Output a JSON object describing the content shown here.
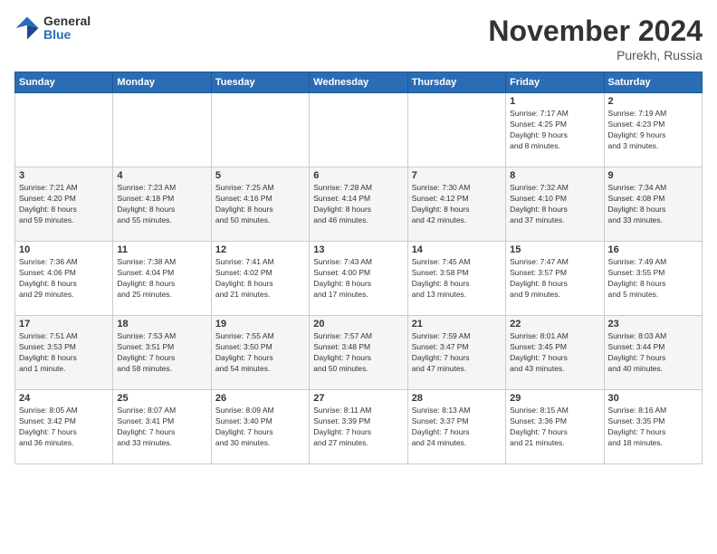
{
  "logo": {
    "general": "General",
    "blue": "Blue"
  },
  "title": "November 2024",
  "location": "Purekh, Russia",
  "days_header": [
    "Sunday",
    "Monday",
    "Tuesday",
    "Wednesday",
    "Thursday",
    "Friday",
    "Saturday"
  ],
  "weeks": [
    [
      {
        "day": "",
        "info": ""
      },
      {
        "day": "",
        "info": ""
      },
      {
        "day": "",
        "info": ""
      },
      {
        "day": "",
        "info": ""
      },
      {
        "day": "",
        "info": ""
      },
      {
        "day": "1",
        "info": "Sunrise: 7:17 AM\nSunset: 4:25 PM\nDaylight: 9 hours\nand 8 minutes."
      },
      {
        "day": "2",
        "info": "Sunrise: 7:19 AM\nSunset: 4:23 PM\nDaylight: 9 hours\nand 3 minutes."
      }
    ],
    [
      {
        "day": "3",
        "info": "Sunrise: 7:21 AM\nSunset: 4:20 PM\nDaylight: 8 hours\nand 59 minutes."
      },
      {
        "day": "4",
        "info": "Sunrise: 7:23 AM\nSunset: 4:18 PM\nDaylight: 8 hours\nand 55 minutes."
      },
      {
        "day": "5",
        "info": "Sunrise: 7:25 AM\nSunset: 4:16 PM\nDaylight: 8 hours\nand 50 minutes."
      },
      {
        "day": "6",
        "info": "Sunrise: 7:28 AM\nSunset: 4:14 PM\nDaylight: 8 hours\nand 46 minutes."
      },
      {
        "day": "7",
        "info": "Sunrise: 7:30 AM\nSunset: 4:12 PM\nDaylight: 8 hours\nand 42 minutes."
      },
      {
        "day": "8",
        "info": "Sunrise: 7:32 AM\nSunset: 4:10 PM\nDaylight: 8 hours\nand 37 minutes."
      },
      {
        "day": "9",
        "info": "Sunrise: 7:34 AM\nSunset: 4:08 PM\nDaylight: 8 hours\nand 33 minutes."
      }
    ],
    [
      {
        "day": "10",
        "info": "Sunrise: 7:36 AM\nSunset: 4:06 PM\nDaylight: 8 hours\nand 29 minutes."
      },
      {
        "day": "11",
        "info": "Sunrise: 7:38 AM\nSunset: 4:04 PM\nDaylight: 8 hours\nand 25 minutes."
      },
      {
        "day": "12",
        "info": "Sunrise: 7:41 AM\nSunset: 4:02 PM\nDaylight: 8 hours\nand 21 minutes."
      },
      {
        "day": "13",
        "info": "Sunrise: 7:43 AM\nSunset: 4:00 PM\nDaylight: 8 hours\nand 17 minutes."
      },
      {
        "day": "14",
        "info": "Sunrise: 7:45 AM\nSunset: 3:58 PM\nDaylight: 8 hours\nand 13 minutes."
      },
      {
        "day": "15",
        "info": "Sunrise: 7:47 AM\nSunset: 3:57 PM\nDaylight: 8 hours\nand 9 minutes."
      },
      {
        "day": "16",
        "info": "Sunrise: 7:49 AM\nSunset: 3:55 PM\nDaylight: 8 hours\nand 5 minutes."
      }
    ],
    [
      {
        "day": "17",
        "info": "Sunrise: 7:51 AM\nSunset: 3:53 PM\nDaylight: 8 hours\nand 1 minute."
      },
      {
        "day": "18",
        "info": "Sunrise: 7:53 AM\nSunset: 3:51 PM\nDaylight: 7 hours\nand 58 minutes."
      },
      {
        "day": "19",
        "info": "Sunrise: 7:55 AM\nSunset: 3:50 PM\nDaylight: 7 hours\nand 54 minutes."
      },
      {
        "day": "20",
        "info": "Sunrise: 7:57 AM\nSunset: 3:48 PM\nDaylight: 7 hours\nand 50 minutes."
      },
      {
        "day": "21",
        "info": "Sunrise: 7:59 AM\nSunset: 3:47 PM\nDaylight: 7 hours\nand 47 minutes."
      },
      {
        "day": "22",
        "info": "Sunrise: 8:01 AM\nSunset: 3:45 PM\nDaylight: 7 hours\nand 43 minutes."
      },
      {
        "day": "23",
        "info": "Sunrise: 8:03 AM\nSunset: 3:44 PM\nDaylight: 7 hours\nand 40 minutes."
      }
    ],
    [
      {
        "day": "24",
        "info": "Sunrise: 8:05 AM\nSunset: 3:42 PM\nDaylight: 7 hours\nand 36 minutes."
      },
      {
        "day": "25",
        "info": "Sunrise: 8:07 AM\nSunset: 3:41 PM\nDaylight: 7 hours\nand 33 minutes."
      },
      {
        "day": "26",
        "info": "Sunrise: 8:09 AM\nSunset: 3:40 PM\nDaylight: 7 hours\nand 30 minutes."
      },
      {
        "day": "27",
        "info": "Sunrise: 8:11 AM\nSunset: 3:39 PM\nDaylight: 7 hours\nand 27 minutes."
      },
      {
        "day": "28",
        "info": "Sunrise: 8:13 AM\nSunset: 3:37 PM\nDaylight: 7 hours\nand 24 minutes."
      },
      {
        "day": "29",
        "info": "Sunrise: 8:15 AM\nSunset: 3:36 PM\nDaylight: 7 hours\nand 21 minutes."
      },
      {
        "day": "30",
        "info": "Sunrise: 8:16 AM\nSunset: 3:35 PM\nDaylight: 7 hours\nand 18 minutes."
      }
    ]
  ]
}
